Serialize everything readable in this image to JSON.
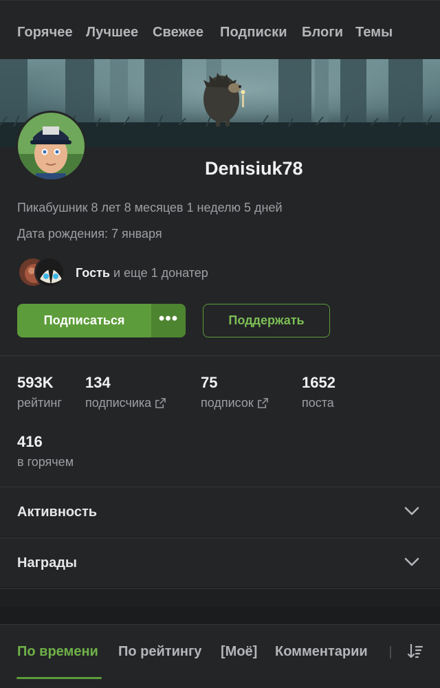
{
  "nav": {
    "items": [
      "Горячее",
      "Лучшее",
      "Свежее",
      "Подписки",
      "Блоги",
      "Темы"
    ]
  },
  "profile": {
    "username": "Denisiuk78",
    "tenure": "Пикабушник 8 лет 8 месяцев 1 неделю 5 дней",
    "birthday": "Дата рождения: 7 января",
    "donators_name": "Гость",
    "donators_rest": " и еще 1 донатер",
    "subscribe_label": "Подписаться",
    "more_label": "•••",
    "support_label": "Поддержать"
  },
  "stats": [
    {
      "value": "593K",
      "label": "рейтинг"
    },
    {
      "value": "134",
      "label": "подписчика"
    },
    {
      "value": "75",
      "label": "подписок"
    },
    {
      "value": "1652",
      "label": "поста"
    },
    {
      "value": "416",
      "label": "в горячем"
    }
  ],
  "sections": {
    "activity": "Активность",
    "awards": "Награды"
  },
  "tabs": [
    "По времени",
    "По рейтингу",
    "[Моё]",
    "Комментарии"
  ],
  "colors": {
    "accent": "#5d9c3a",
    "accent_text": "#6fb248",
    "panel": "#242527",
    "muted_text": "#9d9fa3"
  },
  "icons": {
    "external": "external-link-icon",
    "chevron": "chevron-down-icon",
    "sort": "sort-icon"
  }
}
